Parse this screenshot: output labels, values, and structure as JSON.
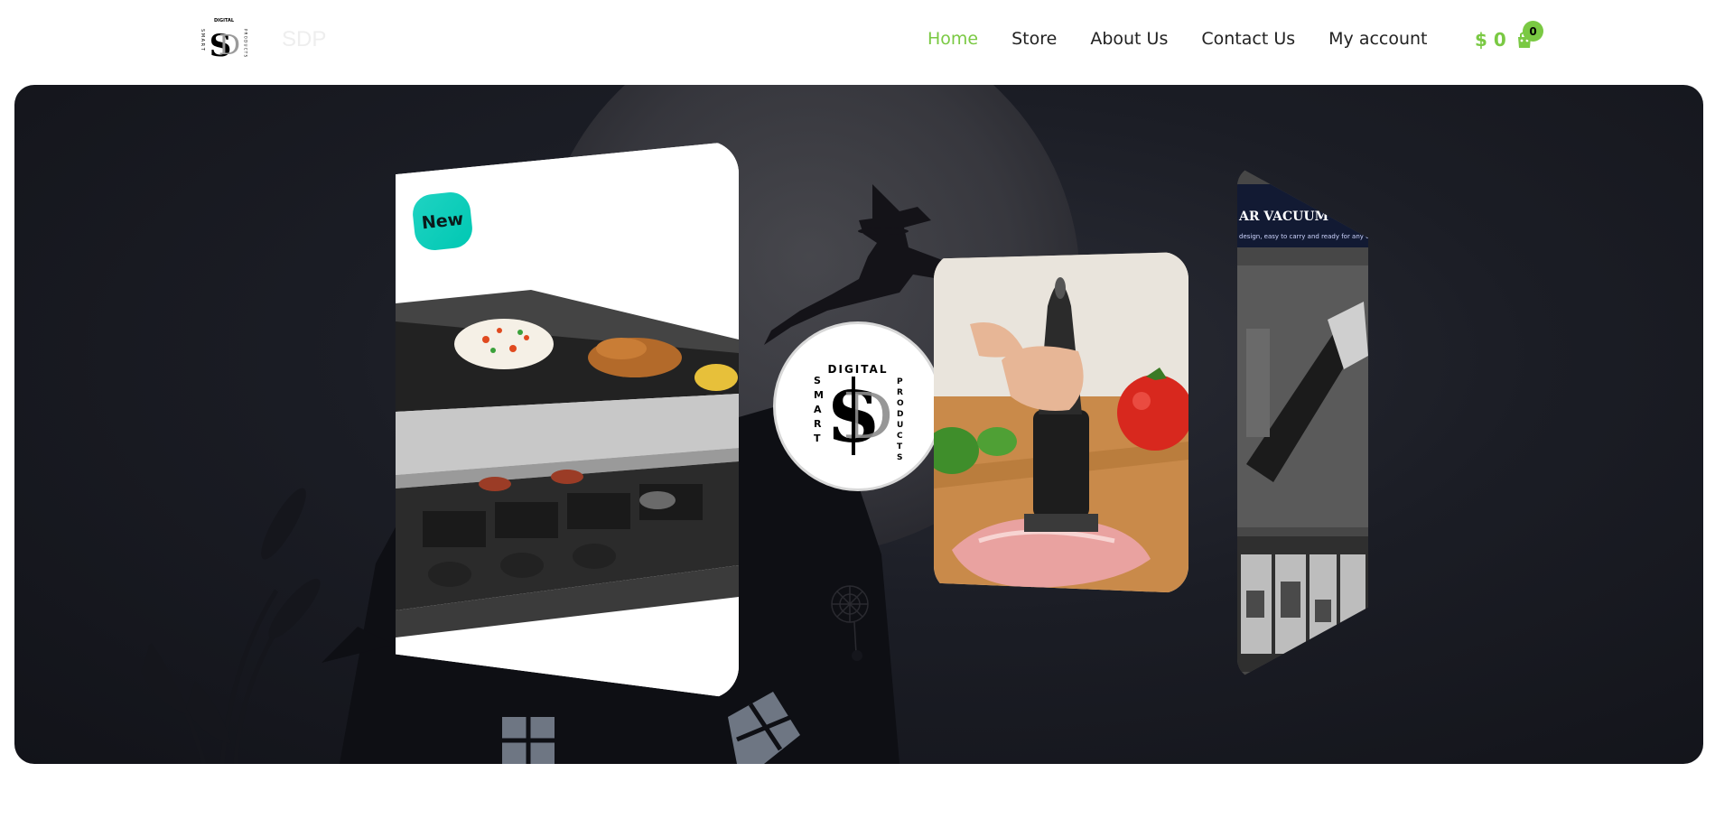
{
  "header": {
    "brand": "SDP",
    "logo": {
      "top_word": "DIGITAL",
      "letters": "SP",
      "left_word": "SMART",
      "right_word": "PRODUCTS"
    },
    "nav": [
      {
        "label": "Home",
        "active": true
      },
      {
        "label": "Store",
        "active": false
      },
      {
        "label": "About Us",
        "active": false
      },
      {
        "label": "Contact Us",
        "active": false
      },
      {
        "label": "My account",
        "active": false
      }
    ],
    "cart": {
      "total": "$ 0",
      "count": "0",
      "icon": "shopping-bag-icon"
    }
  },
  "hero": {
    "theme": "halloween-night",
    "cards": [
      {
        "name": "raclette-grill",
        "badge": "New"
      },
      {
        "name": "brand-circle",
        "top_word": "DIGITAL",
        "left_word": "SMART",
        "right_word": "PRODUCTS"
      },
      {
        "name": "meat-tenderizer"
      },
      {
        "name": "car-vacuum",
        "title": "AR VACUUM CLEANER",
        "subtitle": "design, easy to carry and ready for any cleaning"
      }
    ]
  },
  "colors": {
    "accent": "#7ac943",
    "badge": "#1fd3c2",
    "hero_bg": "#1b1d25"
  }
}
